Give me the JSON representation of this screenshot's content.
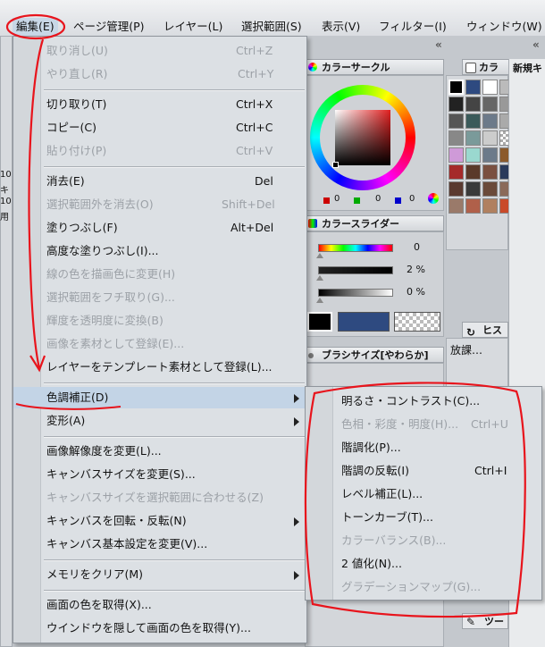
{
  "menubar": {
    "items": [
      "編集(E)",
      "ページ管理(P)",
      "レイヤー(L)",
      "選択範囲(S)",
      "表示(V)",
      "フィルター(I)",
      "ウィンドウ(W)"
    ]
  },
  "panels": {
    "color_circle": {
      "title": "カラーサークル",
      "values": [
        "0",
        "0",
        "0",
        "0",
        "0",
        "0"
      ]
    },
    "color_slider": {
      "title": "カラースライダー",
      "values": [
        "0",
        "2 %",
        "0 %"
      ]
    },
    "brush_size": {
      "title": "ブラシサイズ[やわらか]"
    },
    "swatch_tab": {
      "title": "カラ"
    },
    "history_tab": {
      "title": "ヒス"
    },
    "layer_label": {
      "text": "放課…"
    },
    "tool_tab": {
      "title": "ツー"
    },
    "canvas_tab": {
      "title": "新規キ"
    },
    "left_tools": [
      "10",
      "キ",
      "10",
      "用"
    ]
  },
  "edit_menu": {
    "items": [
      {
        "label": "取り消し(U)",
        "shortcut": "Ctrl+Z",
        "enabled": false
      },
      {
        "label": "やり直し(R)",
        "shortcut": "Ctrl+Y",
        "enabled": false
      },
      {
        "label": "切り取り(T)",
        "shortcut": "Ctrl+X",
        "enabled": true
      },
      {
        "label": "コピー(C)",
        "shortcut": "Ctrl+C",
        "enabled": true
      },
      {
        "label": "貼り付け(P)",
        "shortcut": "Ctrl+V",
        "enabled": false
      },
      {
        "label": "消去(E)",
        "shortcut": "Del",
        "enabled": true
      },
      {
        "label": "選択範囲外を消去(O)",
        "shortcut": "Shift+Del",
        "enabled": false
      },
      {
        "label": "塗りつぶし(F)",
        "shortcut": "Alt+Del",
        "enabled": true
      },
      {
        "label": "高度な塗りつぶし(I)...",
        "shortcut": "",
        "enabled": true
      },
      {
        "label": "線の色を描画色に変更(H)",
        "shortcut": "",
        "enabled": false
      },
      {
        "label": "選択範囲をフチ取り(G)...",
        "shortcut": "",
        "enabled": false
      },
      {
        "label": "輝度を透明度に変換(B)",
        "shortcut": "",
        "enabled": false
      },
      {
        "label": "画像を素材として登録(E)...",
        "shortcut": "",
        "enabled": false
      },
      {
        "label": "レイヤーをテンプレート素材として登録(L)...",
        "shortcut": "",
        "enabled": true
      },
      {
        "label": "色調補正(D)",
        "shortcut": "",
        "enabled": true
      },
      {
        "label": "変形(A)",
        "shortcut": "",
        "enabled": true
      },
      {
        "label": "画像解像度を変更(L)...",
        "shortcut": "",
        "enabled": true
      },
      {
        "label": "キャンバスサイズを変更(S)...",
        "shortcut": "",
        "enabled": true
      },
      {
        "label": "キャンバスサイズを選択範囲に合わせる(Z)",
        "shortcut": "",
        "enabled": false
      },
      {
        "label": "キャンバスを回転・反転(N)",
        "shortcut": "",
        "enabled": true
      },
      {
        "label": "キャンバス基本設定を変更(V)...",
        "shortcut": "",
        "enabled": true
      },
      {
        "label": "メモリをクリア(M)",
        "shortcut": "",
        "enabled": true
      },
      {
        "label": "画面の色を取得(X)...",
        "shortcut": "",
        "enabled": true
      },
      {
        "label": "ウインドウを隠して画面の色を取得(Y)...",
        "shortcut": "",
        "enabled": true
      }
    ]
  },
  "tone_submenu": {
    "items": [
      {
        "label": "明るさ・コントラスト(C)...",
        "shortcut": "",
        "enabled": true
      },
      {
        "label": "色相・彩度・明度(H)...",
        "shortcut": "Ctrl+U",
        "enabled": false
      },
      {
        "label": "階調化(P)...",
        "shortcut": "",
        "enabled": true
      },
      {
        "label": "階調の反転(I)",
        "shortcut": "Ctrl+I",
        "enabled": true
      },
      {
        "label": "レベル補正(L)...",
        "shortcut": "",
        "enabled": true
      },
      {
        "label": "トーンカーブ(T)...",
        "shortcut": "",
        "enabled": true
      },
      {
        "label": "カラーバランス(B)...",
        "shortcut": "",
        "enabled": false
      },
      {
        "label": "2 値化(N)...",
        "shortcut": "",
        "enabled": true
      },
      {
        "label": "グラデーションマップ(G)...",
        "shortcut": "",
        "enabled": false
      }
    ]
  },
  "colors": {
    "annotation": "#e8141c",
    "menu_bg": "#dce0e4",
    "highlight": "#c3d4e6",
    "disabled_text": "#9ca1a7"
  }
}
